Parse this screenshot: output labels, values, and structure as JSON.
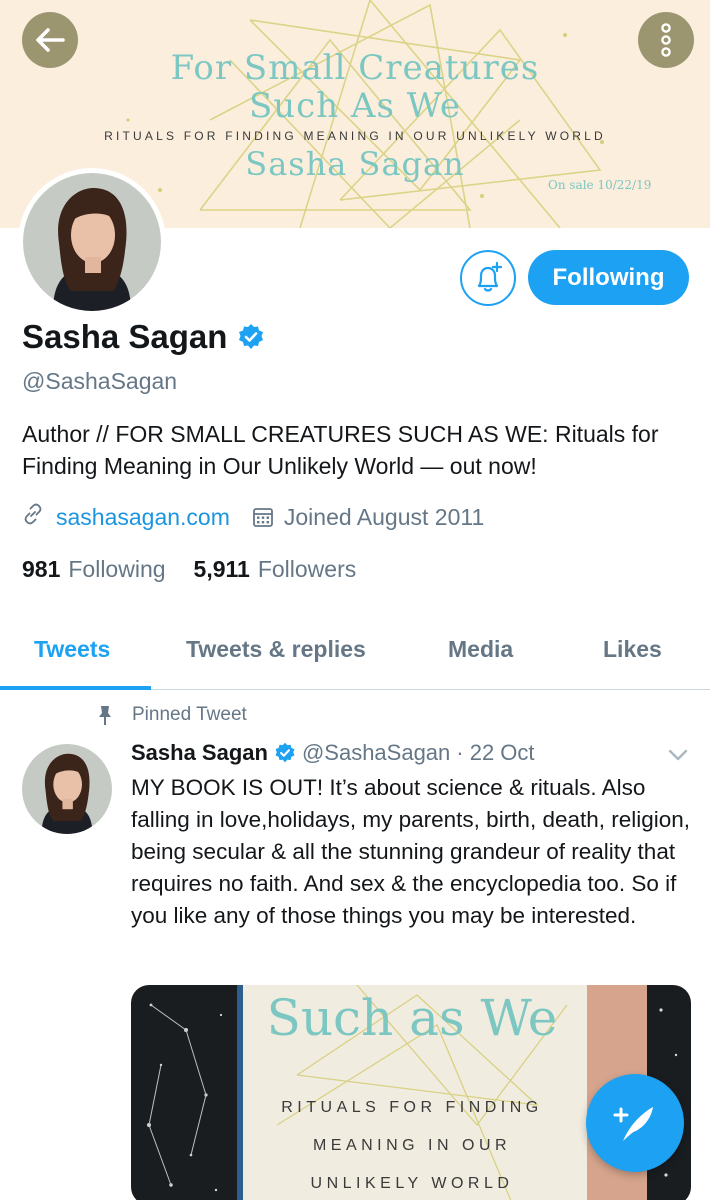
{
  "banner": {
    "title_line1": "For Small Creatures",
    "title_line2": "Such As We",
    "subtitle": "RITUALS FOR FINDING MEANING IN OUR UNLIKELY WORLD",
    "author": "Sasha Sagan",
    "sale_date": "On sale 10/22/19"
  },
  "profile": {
    "name": "Sasha Sagan",
    "handle": "@SashaSagan",
    "bio": "Author // FOR SMALL CREATURES SUCH AS WE: Rituals for Finding Meaning in Our Unlikely World — out now!",
    "website": "sashasagan.com",
    "joined": "Joined August 2011",
    "following_count": "981",
    "following_label": "Following",
    "followers_count": "5,911",
    "followers_label": "Followers",
    "follow_button_label": "Following"
  },
  "tabs": [
    {
      "label": "Tweets",
      "active": true
    },
    {
      "label": "Tweets & replies",
      "active": false
    },
    {
      "label": "Media",
      "active": false
    },
    {
      "label": "Likes",
      "active": false
    }
  ],
  "tweet": {
    "pinned_label": "Pinned Tweet",
    "author_name": "Sasha Sagan",
    "author_handle": "@SashaSagan",
    "date": "· 22 Oct",
    "text": "MY BOOK IS OUT! It’s about science & rituals. Also falling in love,holidays, my parents, birth, death, religion, being secular & all the stunning grandeur of reality that requires no faith. And sex & the encyclopedia too. So if you like any of those things you may be interested.",
    "image": {
      "book_title": "Such as We",
      "line1": "RITUALS FOR FINDING",
      "line2": "MEANING IN OUR",
      "line3": "UNLIKELY WORLD"
    }
  },
  "icons": {
    "back": "arrow-left-icon",
    "more": "more-vertical-icon",
    "notify": "bell-plus-icon",
    "verified": "verified-badge-icon",
    "link": "link-icon",
    "calendar": "calendar-icon",
    "pin": "pin-icon",
    "chevron": "chevron-down-icon",
    "compose": "compose-tweet-icon"
  },
  "colors": {
    "accent": "#1da1f2",
    "banner_bg": "#fbeedd",
    "banner_text": "#7cc7c2",
    "secondary_text": "#657786"
  }
}
